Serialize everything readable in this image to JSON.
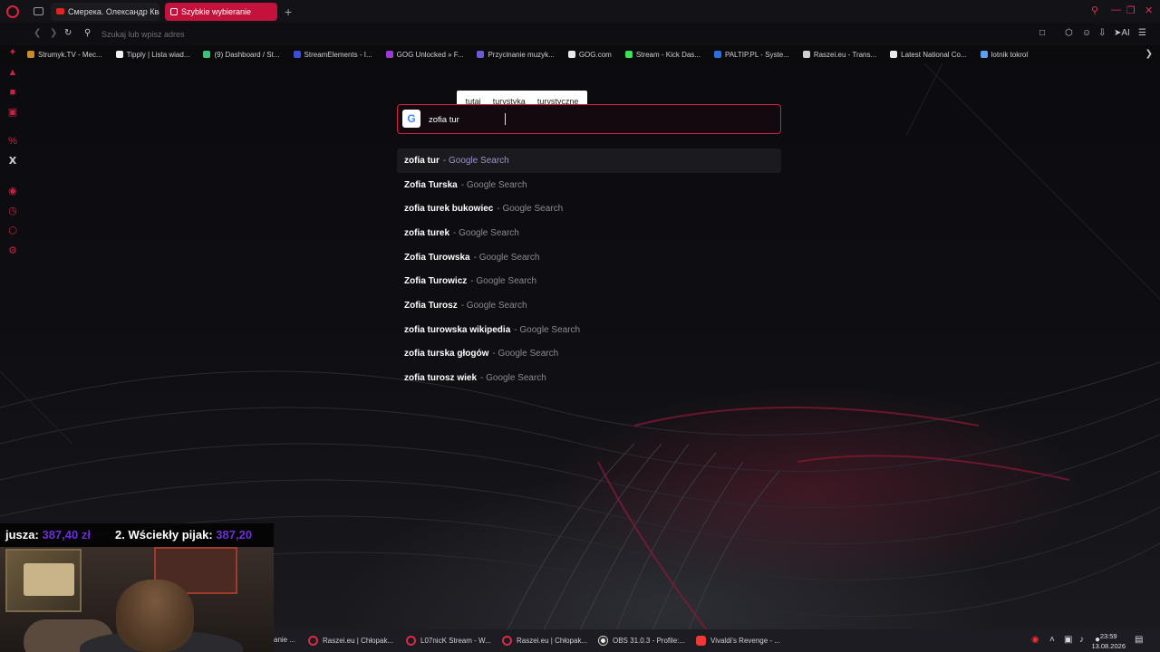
{
  "tabs": [
    {
      "label": "Смерека. Олександр Квартa",
      "state": "inactive"
    },
    {
      "label": "Szybkie wybieranie",
      "state": "active"
    }
  ],
  "address_bar": {
    "placeholder": "Szukaj lub wpisz adres"
  },
  "bookmarks": [
    {
      "label": "Strumyk.TV - Mec...",
      "color": "#c98a2a"
    },
    {
      "label": "Tipply | Lista wiad...",
      "color": "#f0f0f0"
    },
    {
      "label": "(9) Dashboard / St...",
      "color": "#3fbf7a"
    },
    {
      "label": "StreamElements - I...",
      "color": "#3a4fd6"
    },
    {
      "label": "GOG Unlocked » F...",
      "color": "#9b3bd6"
    },
    {
      "label": "Przycinanie muzyk...",
      "color": "#6a5ad6"
    },
    {
      "label": "GOG.com",
      "color": "#e8e8e8"
    },
    {
      "label": "Stream - Kick Das...",
      "color": "#3ae05a"
    },
    {
      "label": "PALTIP.PL - Syste...",
      "color": "#2c6fe0"
    },
    {
      "label": "Raszei.eu - Trans...",
      "color": "#d0d0d0"
    },
    {
      "label": "Latest National Co...",
      "color": "#e8e8e8"
    },
    {
      "label": "lotnik tokrol",
      "color": "#5aa0f0"
    }
  ],
  "chips": [
    "tutaj",
    "turystyka",
    "turystyczne"
  ],
  "search": {
    "value": "zofia tur",
    "engine_icon": "G"
  },
  "suggestions": [
    {
      "match": "zofia tur",
      "rest": "",
      "source": "- Google Search"
    },
    {
      "match": "Zofia Tur",
      "rest": "ska",
      "source": "- Google Search"
    },
    {
      "match": "zofia tur",
      "rest": "ek bukowiec",
      "source": "- Google Search"
    },
    {
      "match": "zofia tur",
      "rest": "ek",
      "source": "- Google Search"
    },
    {
      "match": "Zofia Tur",
      "rest": "owska",
      "source": "- Google Search"
    },
    {
      "match": "Zofia Tur",
      "rest": "owicz",
      "source": "- Google Search"
    },
    {
      "match": "Zofia Tur",
      "rest": "osz",
      "source": "- Google Search"
    },
    {
      "match": "zofia tur",
      "rest": "owska wikipedia",
      "source": "- Google Search"
    },
    {
      "match": "zofia tur",
      "rest": "ska głogów",
      "source": "- Google Search"
    },
    {
      "match": "zofia tur",
      "rest": "osz wiek",
      "source": "- Google Search"
    }
  ],
  "overlay": {
    "entry1_name": "jusza:",
    "entry1_amount": "387,40 zł",
    "entry2_name": "2. Wściekły pijak:",
    "entry2_amount": "387,20"
  },
  "taskbar": [
    {
      "label": "anie ..."
    },
    {
      "label": "Raszei.eu | Chłopak..."
    },
    {
      "label": "L07nicK Stream - W..."
    },
    {
      "label": "Raszei.eu | Chłopak..."
    },
    {
      "label": "OBS 31.0.3 - Profile:..."
    },
    {
      "label": "Vivaldi's Revenge - ..."
    }
  ],
  "clock": {
    "time": "23:59",
    "date": "13.08.2026"
  },
  "ai_label": "AI",
  "colors": {
    "accent": "#d51f45",
    "overlay_amount": "#6b2fd6"
  }
}
